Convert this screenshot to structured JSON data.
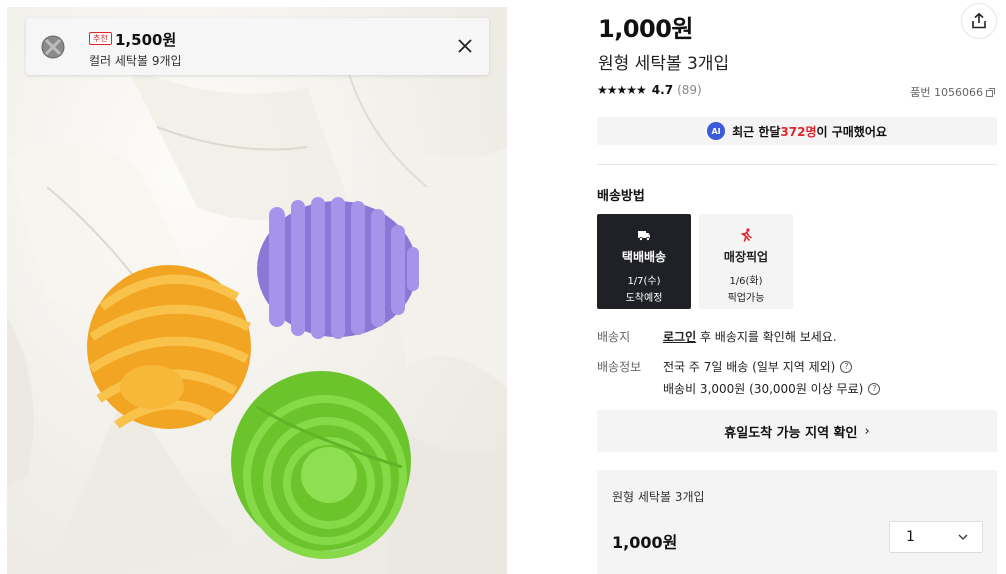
{
  "recommendation": {
    "badge": "추천",
    "price": "1,500원",
    "name": "컬러 세탁볼 9개입"
  },
  "product": {
    "price": "1,000원",
    "title": "원형 세탁볼 3개입",
    "stars": "★★★★★",
    "rating": "4.7",
    "review_count": "(89)",
    "sku": "품번 1056066"
  },
  "ai_summary": {
    "badge": "AI",
    "prefix": "최근 한달 ",
    "highlight": "372명",
    "suffix": "이 구매했어요"
  },
  "shipping": {
    "heading": "배송방법",
    "options": [
      {
        "label": "택배배송",
        "date": "1/7(수)",
        "note": "도착예정",
        "selected": true
      },
      {
        "label": "매장픽업",
        "date": "1/6(화)",
        "note": "픽업가능",
        "selected": false
      }
    ],
    "address_label": "배송지",
    "address_link": "로그인",
    "address_text": " 후 배송지를 확인해 보세요.",
    "info_label": "배송정보",
    "info_line1": "전국 주 7일 배송 (일부 지역 제외)",
    "info_line2": "배송비 3,000원 (30,000원 이상 무료)"
  },
  "holiday_button": "휴일도착 가능 지역 확인",
  "option_panel": {
    "name": "원형 세탁볼 3개입",
    "price": "1,000원",
    "quantity": "1"
  },
  "colors": {
    "accent_red": "#e0262d",
    "dark_button": "#1f2126",
    "ai_blue": "#3b5bdb",
    "ball_yellow": "#f7b12f",
    "ball_purple": "#9a86e0",
    "ball_green": "#7dd43a"
  }
}
